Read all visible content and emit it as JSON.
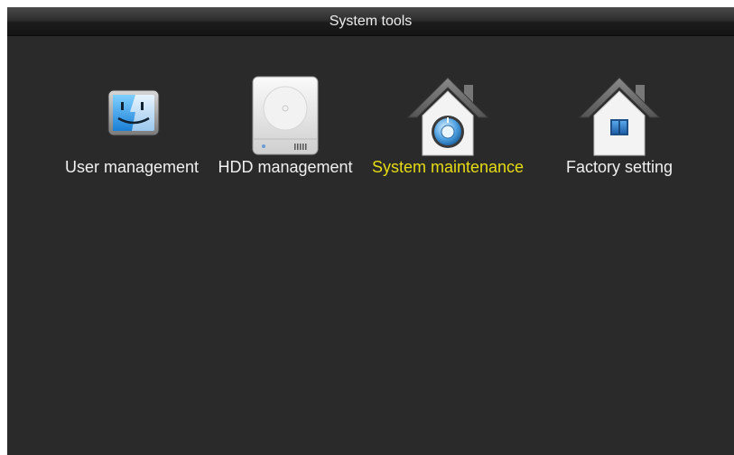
{
  "window": {
    "title": "System tools"
  },
  "menu": {
    "selected_index": 2,
    "items": [
      {
        "label": "User management",
        "icon": "finder-face-icon"
      },
      {
        "label": "HDD management",
        "icon": "hard-drive-icon"
      },
      {
        "label": "System maintenance",
        "icon": "house-gear-icon"
      },
      {
        "label": "Factory setting",
        "icon": "house-icon"
      }
    ]
  },
  "colors": {
    "background": "#2a2a2a",
    "label": "#f0f0f0",
    "selected_label": "#e6dc14"
  }
}
